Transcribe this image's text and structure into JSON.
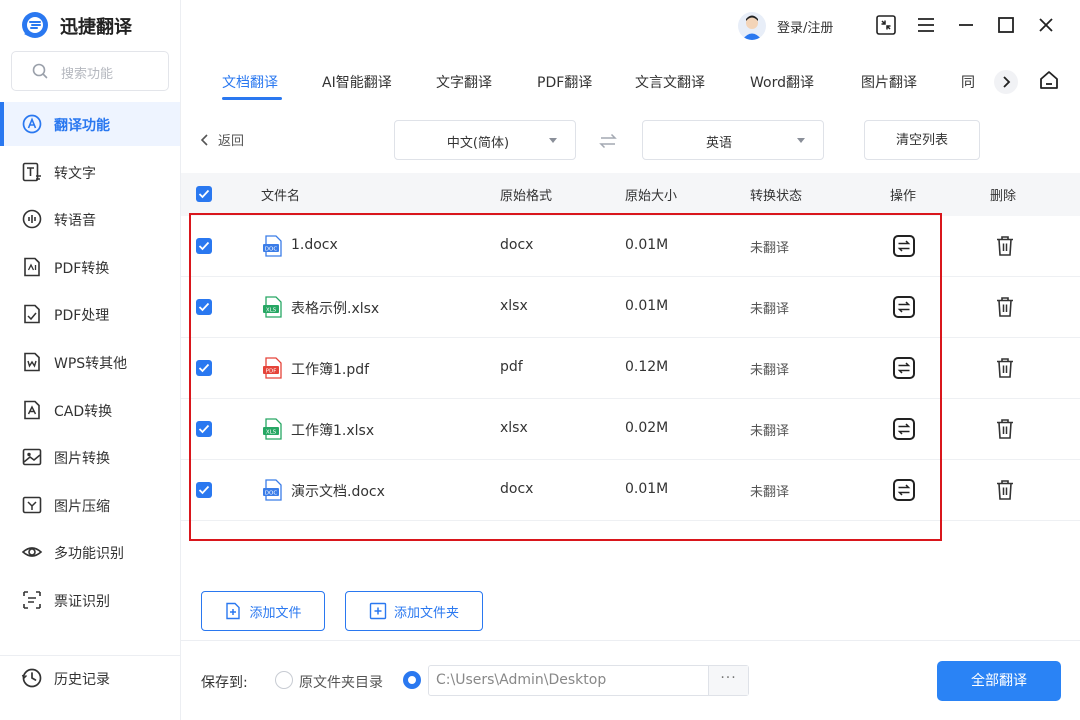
{
  "app": {
    "title": "迅捷翻译"
  },
  "search": {
    "placeholder": "搜索功能"
  },
  "sidebar": {
    "items": [
      {
        "label": "翻译功能",
        "icon": "translate-icon",
        "active": true
      },
      {
        "label": "转文字",
        "icon": "text-convert-icon"
      },
      {
        "label": "转语音",
        "icon": "voice-icon"
      },
      {
        "label": "PDF转换",
        "icon": "pdf-convert-icon"
      },
      {
        "label": "PDF处理",
        "icon": "pdf-process-icon"
      },
      {
        "label": "WPS转其他",
        "icon": "wps-icon"
      },
      {
        "label": "CAD转换",
        "icon": "cad-icon"
      },
      {
        "label": "图片转换",
        "icon": "image-convert-icon"
      },
      {
        "label": "图片压缩",
        "icon": "image-compress-icon"
      },
      {
        "label": "多功能识别",
        "icon": "eye-icon"
      },
      {
        "label": "票证识别",
        "icon": "ticket-icon"
      }
    ],
    "history": "历史记录"
  },
  "topbar": {
    "login": "登录/注册"
  },
  "tabs": [
    "文档翻译",
    "AI智能翻译",
    "文字翻译",
    "PDF翻译",
    "文言文翻译",
    "Word翻译",
    "图片翻译",
    "同"
  ],
  "toolbar": {
    "back": "返回",
    "source_lang": "中文(简体)",
    "target_lang": "英语",
    "clear": "清空列表"
  },
  "table": {
    "headers": [
      "文件名",
      "原始格式",
      "原始大小",
      "转换状态",
      "操作",
      "删除"
    ],
    "rows": [
      {
        "name": "1.docx",
        "format": "docx",
        "size": "0.01M",
        "status": "未翻译",
        "type": "doc"
      },
      {
        "name": "表格示例.xlsx",
        "format": "xlsx",
        "size": "0.01M",
        "status": "未翻译",
        "type": "xls"
      },
      {
        "name": "工作簿1.pdf",
        "format": "pdf",
        "size": "0.12M",
        "status": "未翻译",
        "type": "pdf"
      },
      {
        "name": "工作簿1.xlsx",
        "format": "xlsx",
        "size": "0.02M",
        "status": "未翻译",
        "type": "xls"
      },
      {
        "name": "演示文档.docx",
        "format": "docx",
        "size": "0.01M",
        "status": "未翻译",
        "type": "doc"
      }
    ]
  },
  "actions": {
    "add_file": "添加文件",
    "add_folder": "添加文件夹"
  },
  "footer": {
    "save_to": "保存到:",
    "option_source": "原文件夹目录",
    "path": "C:\\Users\\Admin\\Desktop",
    "more": "···",
    "translate_all": "全部翻译"
  },
  "colors": {
    "accent": "#2a78f0",
    "highlight": "#d9161c"
  }
}
